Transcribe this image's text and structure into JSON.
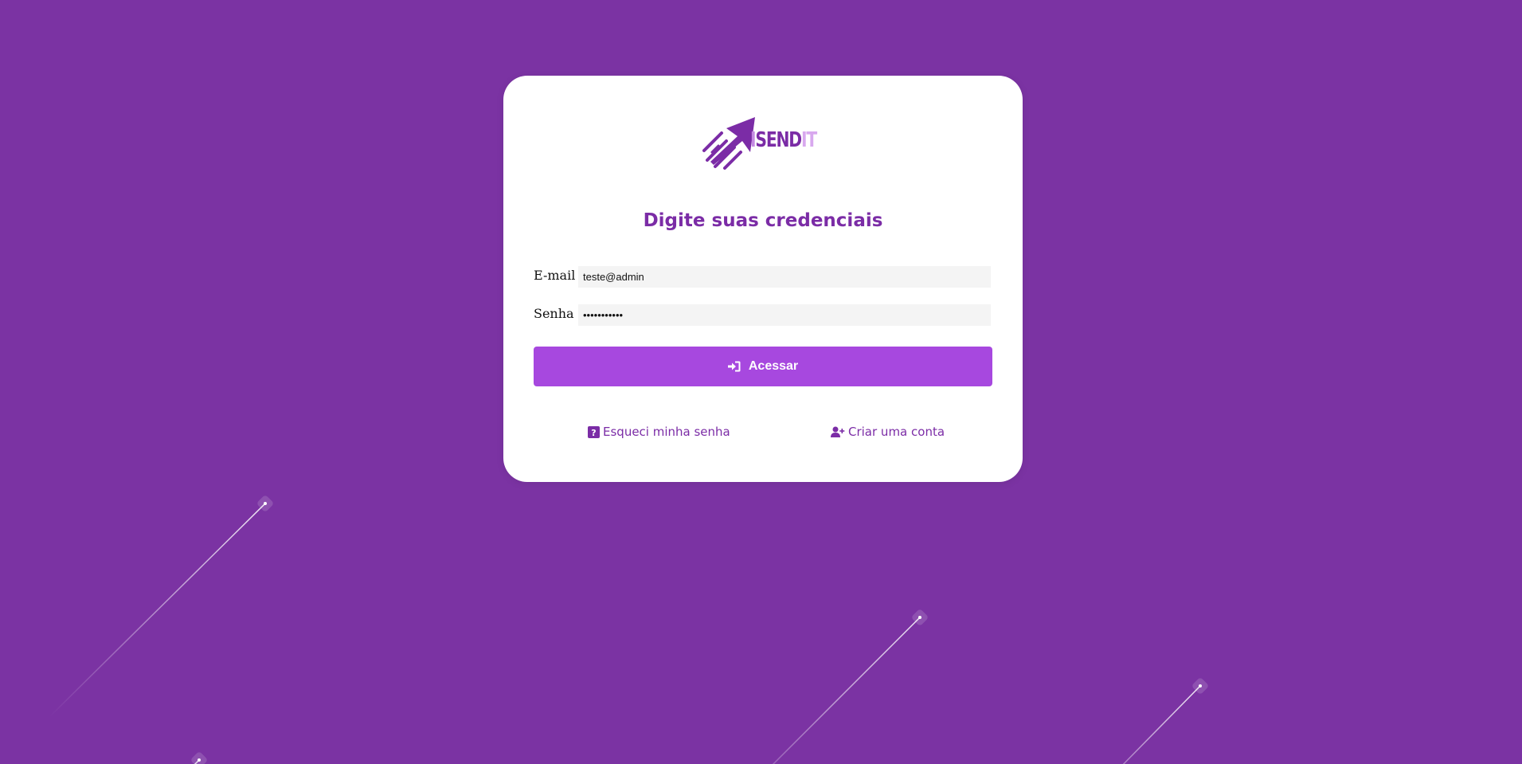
{
  "logo": {
    "text_prefix": "I",
    "text_main": "SEND",
    "text_suffix": "IT",
    "icon": "rocket-arrow-icon"
  },
  "login": {
    "title": "Digite suas credenciais",
    "email_label": "E-mail",
    "email_value": "teste@admin",
    "password_label": "Senha",
    "password_value": "•••••••••••",
    "submit_label": "Acessar",
    "submit_icon": "sign-in-icon"
  },
  "links": {
    "forgot_label": "Esqueci minha senha",
    "forgot_icon": "question-square-icon",
    "create_label": "Criar uma conta",
    "create_icon": "user-plus-icon"
  },
  "colors": {
    "background": "#7b33a3",
    "primary": "#7b2ca6",
    "button": "#a748df",
    "input_bg": "#f4f4f4"
  }
}
